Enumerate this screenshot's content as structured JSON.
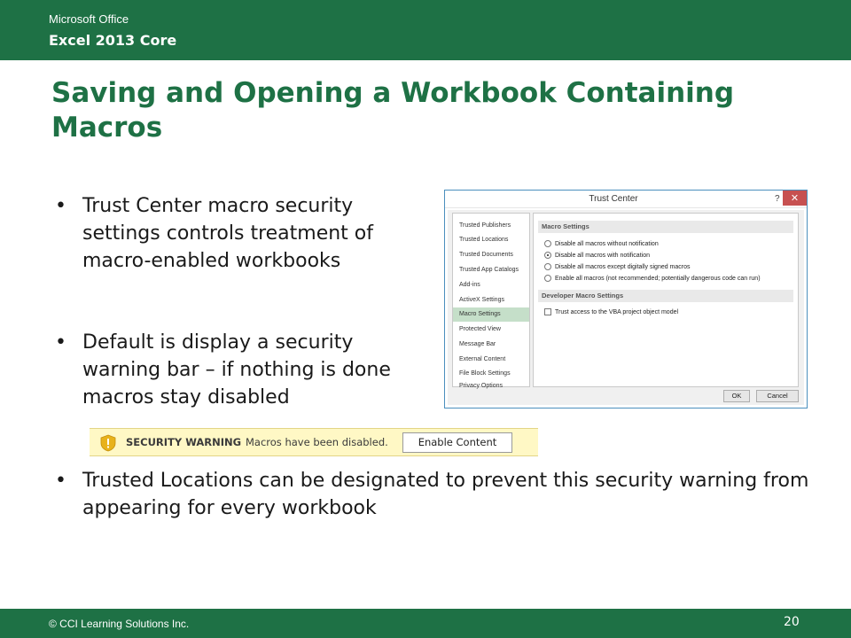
{
  "header": {
    "line1": "Microsoft Office",
    "line2": "Excel 2013 Core"
  },
  "title": "Saving and Opening a Workbook Containing Macros",
  "bullets": [
    {
      "marker": "•",
      "text": "Trust Center macro security settings controls treatment of macro-enabled workbooks"
    },
    {
      "marker": "•",
      "text": "Default is display a security warning bar – if nothing is done macros stay disabled"
    },
    {
      "marker": "•",
      "text": "Trusted Locations can be designated to prevent this security warning from appearing for every workbook"
    }
  ],
  "dialog": {
    "title": "Trust Center",
    "help": "?",
    "close": "✕",
    "nav_items": [
      "Trusted Publishers",
      "Trusted Locations",
      "Trusted Documents",
      "Trusted App Catalogs",
      "Add-ins",
      "ActiveX Settings",
      "Macro Settings",
      "Protected View",
      "Message Bar",
      "External Content",
      "File Block Settings",
      "Privacy Options"
    ],
    "selected_nav": "Macro Settings",
    "macro_settings_heading": "Macro Settings",
    "macro_options": [
      "Disable all macros without notification",
      "Disable all macros with notification",
      "Disable all macros except digitally signed macros",
      "Enable all macros (not recommended; potentially dangerous code can run)"
    ],
    "selected_option": "Disable all macros with notification",
    "developer_heading": "Developer Macro Settings",
    "developer_checkbox": "Trust access to the VBA project object model",
    "ok_label": "OK",
    "cancel_label": "Cancel"
  },
  "security_bar": {
    "label": "SECURITY WARNING",
    "message": "Macros have been disabled.",
    "button": "Enable Content",
    "icon": "warning-shield-icon",
    "icon_color": "#e8b21b"
  },
  "footer": {
    "copyright": "© CCI Learning Solutions Inc.",
    "page_number": "20"
  },
  "colors": {
    "brand_green": "#1e7145",
    "selected_nav_bg": "#c5dfc9",
    "close_button": "#c75050",
    "warning_bar_bg": "#fff8c5"
  }
}
